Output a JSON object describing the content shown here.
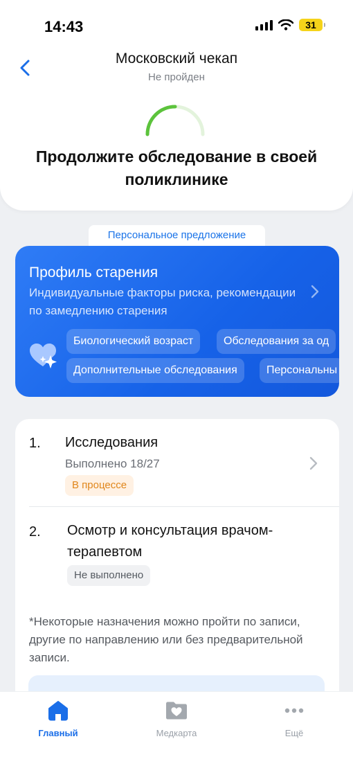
{
  "status_bar": {
    "time": "14:43",
    "battery": "31"
  },
  "header": {
    "title": "Московский чекап",
    "subtitle": "Не пройден",
    "progress_fraction": 0.25,
    "headline": "Продолжите обследование в своей поликлинике"
  },
  "offer": {
    "tag": "Персональное предложение",
    "title": "Профиль старения",
    "description": "Индивидуальные факторы риска, рекомендации по замедлению старения",
    "chips_row1": [
      "Биологический возраст",
      "Обследования за од"
    ],
    "chips_row2": [
      "Дополнительные обследования",
      "Персональны"
    ]
  },
  "steps": [
    {
      "number": "1.",
      "title": "Исследования",
      "progress_text": "Выполнено 18/27",
      "status": "В процессе"
    },
    {
      "number": "2.",
      "title": "Осмотр и консультация врачом-терапевтом",
      "status": "Не выполнено"
    }
  ],
  "footnote": "*Некоторые назначения можно пройти по записи, другие по направлению или без предварительной записи.",
  "tabs": [
    {
      "label": "Главный",
      "active": true
    },
    {
      "label": "Медкарта",
      "active": false
    },
    {
      "label": "Ещё",
      "active": false
    }
  ],
  "colors": {
    "accent": "#1a6ee8",
    "progress_green": "#5cc33c",
    "badge_orange": "#e0861b"
  }
}
